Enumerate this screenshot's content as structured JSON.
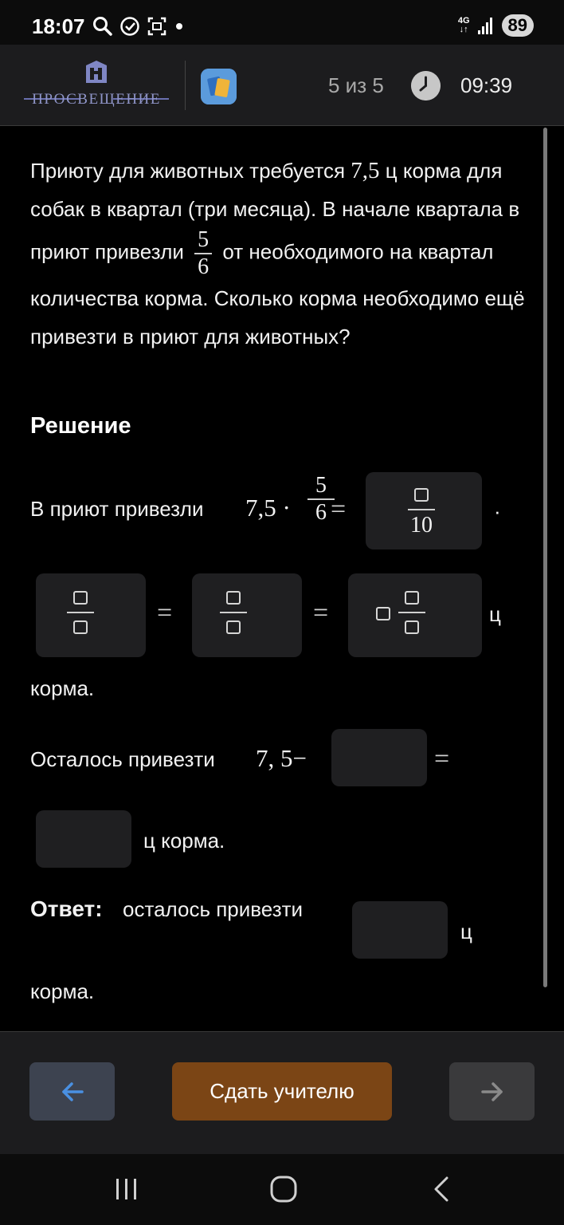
{
  "status_bar": {
    "time": "18:07",
    "network": "4G",
    "battery": "89"
  },
  "header": {
    "logo_text": "ПРОСВЕЩЕНИЕ",
    "progress": "5 из 5",
    "timer": "09:39"
  },
  "task": {
    "part1": "Приюту для животных требуется",
    "amount": "7,5",
    "part2": "ц корма для собак в квартал (три месяца). В начале квартала в приют привезли",
    "frac_num": "5",
    "frac_den": "6",
    "part3": "от необходимого на квартал количества корма. Сколько корма необходимо ещё привезти в приют для животных?"
  },
  "solution": {
    "heading": "Решение",
    "line1_text": "В приют привезли",
    "line1_expr": "7,5 ·",
    "frac_num": "5",
    "frac_den": "6",
    "equals": "=",
    "box1_den": "10",
    "dot": "·",
    "unit_c": "ц",
    "korma": "корма.",
    "remaining_text": "Осталось привезти",
    "remaining_expr": "7, 5−",
    "unit_korma": "ц корма.",
    "answer_label": "Ответ:",
    "answer_text": "осталось привезти",
    "answer_unit": "ц",
    "answer_korma": "корма."
  },
  "footer": {
    "submit_label": "Сдать учителю"
  },
  "colors": {
    "submit": "#7b4515",
    "back_arrow": "#4a90e2",
    "logo": "#8f95c8"
  }
}
